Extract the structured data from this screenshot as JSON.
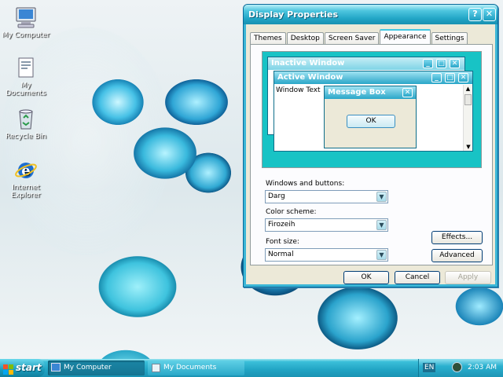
{
  "desktop": {
    "icons": [
      {
        "label": "My Computer",
        "icon": "my-computer-icon"
      },
      {
        "label": "My Documents",
        "icon": "my-documents-icon"
      },
      {
        "label": "Recycle Bin",
        "icon": "recycle-bin-icon"
      },
      {
        "label": "Internet Explorer",
        "icon": "internet-explorer-icon"
      }
    ]
  },
  "dialog": {
    "title": "Display Properties",
    "help_label": "?",
    "close_label": "✕",
    "tabs": [
      "Themes",
      "Desktop",
      "Screen Saver",
      "Appearance",
      "Settings"
    ],
    "active_tab": "Appearance",
    "preview": {
      "inactive_title": "Inactive Window",
      "active_title": "Active Window",
      "window_text": "Window Text",
      "message_title": "Message Box",
      "ok_label": "OK"
    },
    "windows_buttons_label": "Windows and buttons:",
    "windows_buttons_value": "Darg",
    "color_scheme_label": "Color scheme:",
    "color_scheme_value": "Firozeih",
    "font_size_label": "Font size:",
    "font_size_value": "Normal",
    "effects_label": "Effects...",
    "advanced_label": "Advanced",
    "ok_label": "OK",
    "cancel_label": "Cancel",
    "apply_label": "Apply"
  },
  "taskbar": {
    "start_label": "start",
    "tasks": [
      {
        "label": "My Computer"
      },
      {
        "label": "My Documents"
      }
    ],
    "language": "EN",
    "clock": "2:03 AM"
  },
  "colors": {
    "accent": "#22a6c6",
    "preview_desktop": "#18c3c5",
    "dialog_bg": "#ECE9D8"
  }
}
